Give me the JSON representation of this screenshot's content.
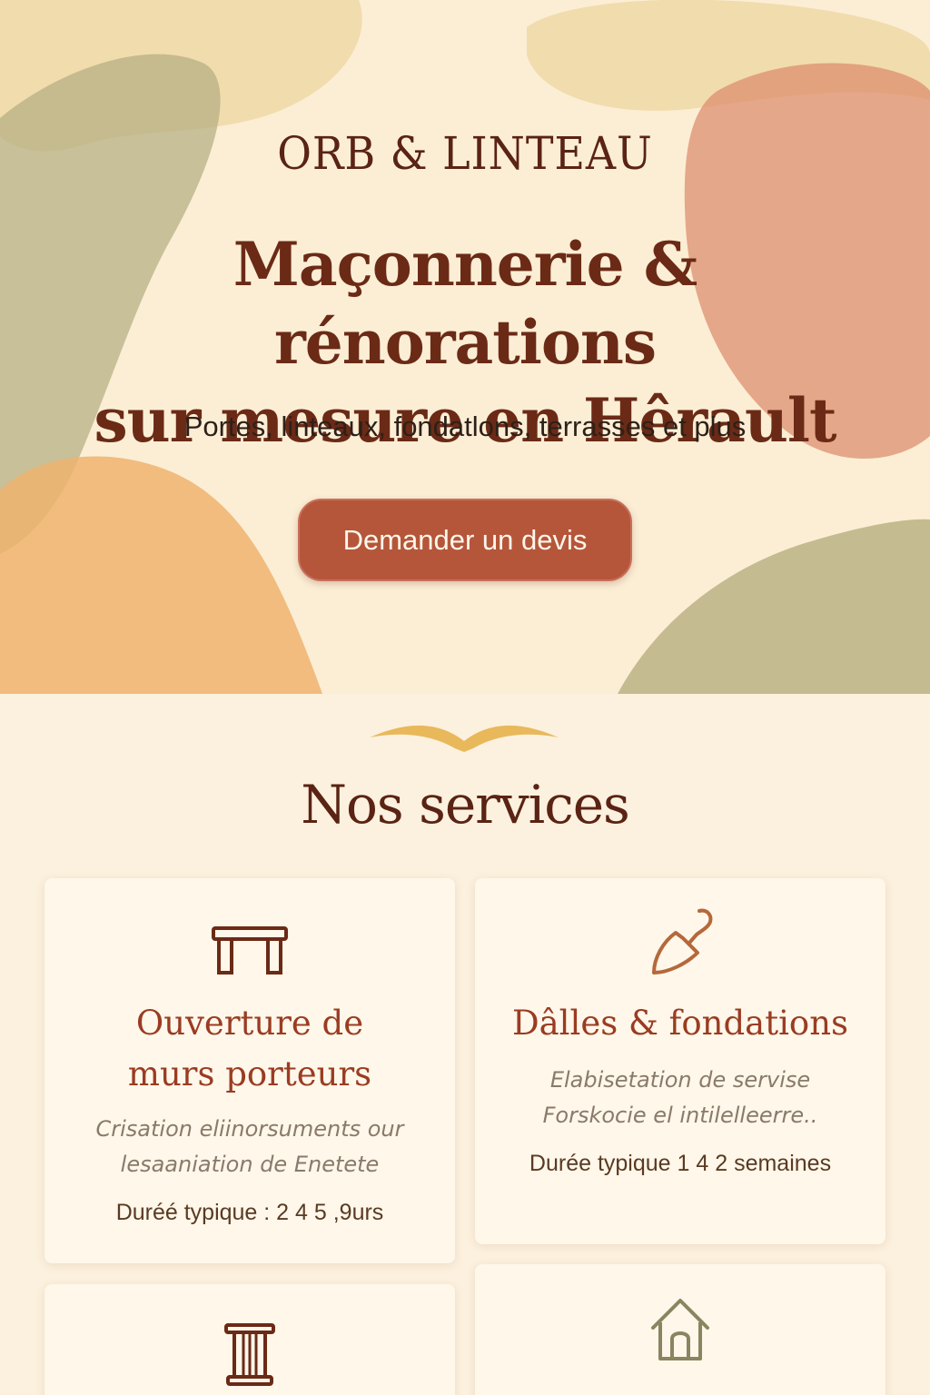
{
  "header": {
    "brand": "ORB & LINTEAU",
    "headline_line1": "Maçonnerie & rénorations",
    "headline_line2": "sur mesure en Hêrault",
    "tagline": "Portes, linteaux, fondatlons, terrasses et plus",
    "cta_label": "Demander un devis"
  },
  "services": {
    "title": "Nos services",
    "cards": [
      {
        "title_line1": "Ouverture de",
        "title_line2": "murs porteurs",
        "desc_line1": "Crisation eliinorsuments our",
        "desc_line2": "lesaaniation de Enetete",
        "duration": "Duréé typique : 2 4 5 ,9urs",
        "icon": "lintel-icon"
      },
      {
        "title_line1": "Dâlles & fondations",
        "desc_line1": "Elabisetation de servise",
        "desc_line2": "Forskocie el intilelleerre..",
        "duration": "Durée typique  1 4 2 semaines",
        "icon": "trowel-icon"
      },
      {
        "icon": "column-icon"
      },
      {
        "icon": "house-icon"
      }
    ]
  },
  "colors": {
    "accent": "#b5563a",
    "heading": "#6b2a16",
    "card_title": "#9a3c22",
    "ornament": "#e8b85a"
  }
}
